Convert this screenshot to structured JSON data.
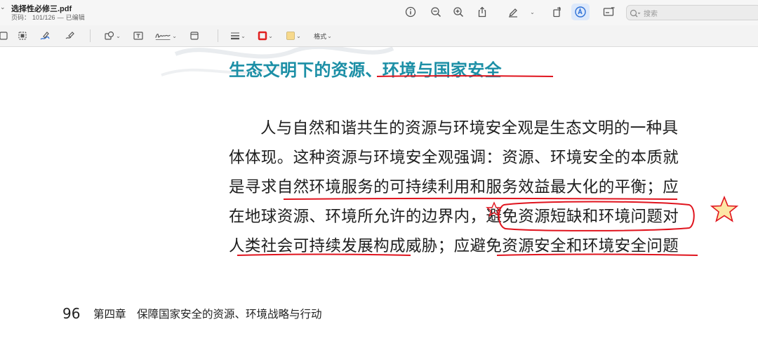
{
  "window": {
    "title": "选择性必修三.pdf",
    "page_info_label": "页码：",
    "page_info": "101/126",
    "separator": "—",
    "edit_status": "已编辑"
  },
  "toolbar": {
    "icons": [
      "info-icon",
      "zoom-out-icon",
      "zoom-in-icon",
      "share-icon",
      "highlight-pen-icon",
      "rotate-icon",
      "markup-icon",
      "form-fill-icon"
    ],
    "search_placeholder": "搜索"
  },
  "annotation_toolbar": {
    "icons": [
      "sidebar-toggle-icon",
      "text-select-icon",
      "sketch-icon",
      "draw-icon",
      "shapes-icon",
      "textbox-icon",
      "signature-icon",
      "note-icon",
      "line-style-icon",
      "border-color-icon",
      "fill-color-icon"
    ],
    "format_label": "格式",
    "border_color": "#e02020",
    "fill_color": "#f7d98c"
  },
  "document": {
    "heading": "生态文明下的资源、环境与国家安全",
    "heading_color": "#1c8fa6",
    "paragraph_lines": [
      "人与自然和谐共生的资源与环境安全观是生态文明的一种具",
      "体体现。这种资源与环境安全观强调：资源、环境安全的本质就",
      "是寻求自然环境服务的可持续利用和服务效益最大化的平衡；应",
      "在地球资源、环境所允许的边界内，避免资源短缺和环境问题对",
      "人类社会可持续发展构成威胁；应避免资源安全和环境安全问题"
    ],
    "page_number": "96",
    "footer_text": "第四章　保障国家安全的资源、环境战略与行动"
  },
  "markup": {
    "ink_color": "#e0141e",
    "star_fill": "#fde7a6"
  }
}
